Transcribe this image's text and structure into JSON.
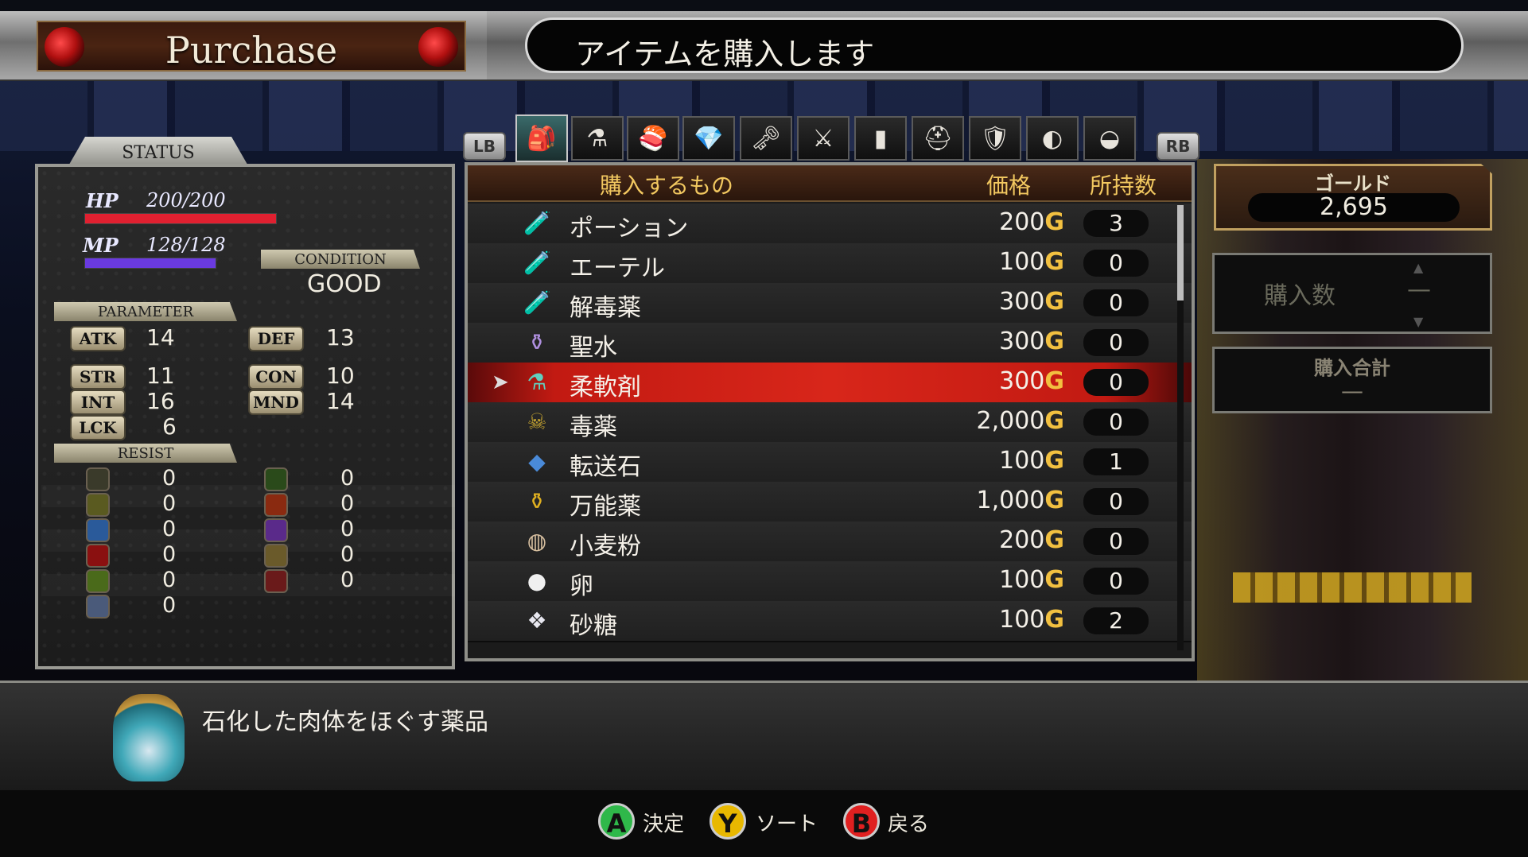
{
  "header": {
    "title": "Purchase",
    "message": "アイテムを購入します"
  },
  "status": {
    "tab_label": "STATUS",
    "hp_label": "HP",
    "hp_value": "200/200",
    "hp_fraction": 1.0,
    "mp_label": "MP",
    "mp_value": "128/128",
    "mp_fraction": 1.0,
    "condition_label": "CONDITION",
    "condition_value": "GOOD",
    "parameter_label": "PARAMETER",
    "params": [
      {
        "label": "ATK",
        "value": "14"
      },
      {
        "label": "DEF",
        "value": "13"
      },
      {
        "label": "STR",
        "value": "11"
      },
      {
        "label": "CON",
        "value": "10"
      },
      {
        "label": "INT",
        "value": "16"
      },
      {
        "label": "MND",
        "value": "14"
      },
      {
        "label": "LCK",
        "value": "6"
      }
    ],
    "resist_label": "RESIST",
    "resists": [
      {
        "icon": "moon-icon",
        "value": "0"
      },
      {
        "icon": "wind-arrow-icon",
        "value": "0"
      },
      {
        "icon": "earth-icon",
        "value": "0"
      },
      {
        "icon": "fire-icon",
        "value": "0"
      },
      {
        "icon": "ice-crystal-icon",
        "value": "0"
      },
      {
        "icon": "lightning-icon",
        "value": "0"
      },
      {
        "icon": "blood-drop-icon",
        "value": "0"
      },
      {
        "icon": "holy-cross-icon",
        "value": "0"
      },
      {
        "icon": "poison-icon",
        "value": "0"
      },
      {
        "icon": "curse-skull-icon",
        "value": "0"
      },
      {
        "icon": "stone-icon",
        "value": "0"
      }
    ]
  },
  "tabs": {
    "lb_label": "LB",
    "rb_label": "RB",
    "categories": [
      {
        "icon": "backpack-icon"
      },
      {
        "icon": "potion-icon"
      },
      {
        "icon": "food-icon"
      },
      {
        "icon": "crystal-icon"
      },
      {
        "icon": "key-icon"
      },
      {
        "icon": "crossed-swords-icon"
      },
      {
        "icon": "ammo-icon"
      },
      {
        "icon": "helmet-icon"
      },
      {
        "icon": "armor-icon"
      },
      {
        "icon": "bracer-icon"
      },
      {
        "icon": "cloak-icon"
      }
    ]
  },
  "list": {
    "col_item": "購入するもの",
    "col_price": "価格",
    "col_owned": "所持数",
    "currency": "G",
    "items": [
      {
        "icon": "red-potion-icon",
        "glyph": "🧪",
        "name": "ポーション",
        "price": "200",
        "owned": "3"
      },
      {
        "icon": "blue-potion-icon",
        "glyph": "🧪",
        "name": "エーテル",
        "price": "100",
        "owned": "0"
      },
      {
        "icon": "antidote-icon",
        "glyph": "🧪",
        "name": "解毒薬",
        "price": "300",
        "owned": "0"
      },
      {
        "icon": "holy-water-icon",
        "glyph": "⚱",
        "name": "聖水",
        "price": "300",
        "owned": "0"
      },
      {
        "icon": "softener-icon",
        "glyph": "⚗",
        "name": "柔軟剤",
        "price": "300",
        "owned": "0"
      },
      {
        "icon": "poison-bottle-icon",
        "glyph": "☠",
        "name": "毒薬",
        "price": "2,000",
        "owned": "0"
      },
      {
        "icon": "warp-stone-icon",
        "glyph": "◆",
        "name": "転送石",
        "price": "100",
        "owned": "1"
      },
      {
        "icon": "elixir-icon",
        "glyph": "⚱",
        "name": "万能薬",
        "price": "1,000",
        "owned": "0"
      },
      {
        "icon": "flour-icon",
        "glyph": "◍",
        "name": "小麦粉",
        "price": "200",
        "owned": "0"
      },
      {
        "icon": "egg-icon",
        "glyph": "●",
        "name": "卵",
        "price": "100",
        "owned": "0"
      },
      {
        "icon": "sugar-icon",
        "glyph": "❖",
        "name": "砂糖",
        "price": "100",
        "owned": "2"
      }
    ],
    "selected_index": 4
  },
  "gold": {
    "label": "ゴールド",
    "value": "2,695"
  },
  "quantity": {
    "label": "購入数",
    "value": "—"
  },
  "total": {
    "label": "購入合計",
    "value": "—"
  },
  "description": {
    "text": "石化した肉体をほぐす薬品"
  },
  "footer": {
    "buttons": [
      {
        "key": "A",
        "label": "決定",
        "color": "#2fb84a"
      },
      {
        "key": "Y",
        "label": "ソート",
        "color": "#e8b800"
      },
      {
        "key": "B",
        "label": "戻る",
        "color": "#e02020"
      }
    ]
  },
  "colors": {
    "hp_bar": "#e02030",
    "mp_bar": "#6a3ae0",
    "selection": "#d8261a",
    "gold_accent": "#f2c040"
  }
}
